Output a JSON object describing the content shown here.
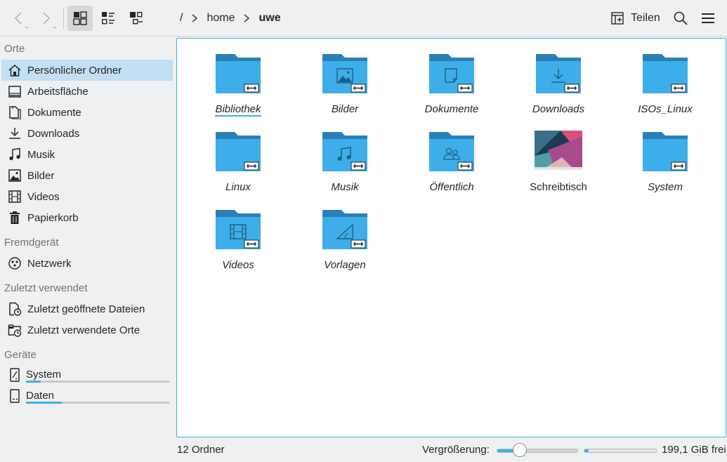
{
  "toolbar": {
    "back_icon": "go-previous-icon",
    "forward_icon": "go-next-icon",
    "view_modes": [
      "icons-view-icon",
      "details-view-icon",
      "compact-view-icon"
    ],
    "breadcrumb": [
      "/",
      "home",
      "uwe"
    ],
    "share_label": "Teilen",
    "search_icon": "search-icon",
    "menu_icon": "hamburger-menu-icon"
  },
  "sidebar": {
    "sections": {
      "places": "Orte",
      "remote": "Fremdgerät",
      "recent": "Zuletzt verwendet",
      "devices": "Geräte"
    },
    "places": [
      {
        "label": "Persönlicher Ordner",
        "icon": "home-icon",
        "selected": true
      },
      {
        "label": "Arbeitsfläche",
        "icon": "desktop-icon"
      },
      {
        "label": "Dokumente",
        "icon": "documents-icon"
      },
      {
        "label": "Downloads",
        "icon": "download-icon"
      },
      {
        "label": "Musik",
        "icon": "music-note-icon"
      },
      {
        "label": "Bilder",
        "icon": "image-icon"
      },
      {
        "label": "Videos",
        "icon": "film-icon"
      },
      {
        "label": "Papierkorb",
        "icon": "trash-icon"
      }
    ],
    "remote": [
      {
        "label": "Netzwerk",
        "icon": "network-icon"
      }
    ],
    "recent": [
      {
        "label": "Zuletzt geöffnete Dateien",
        "icon": "recent-files-icon"
      },
      {
        "label": "Zuletzt verwendete Orte",
        "icon": "recent-places-icon"
      }
    ],
    "devices": [
      {
        "label": "System",
        "icon": "drive-icon",
        "usage": 0.1
      },
      {
        "label": "Daten",
        "icon": "drive-icon",
        "usage": 0.25
      }
    ]
  },
  "content": {
    "items": [
      {
        "label": "Bibliothek",
        "icon": "folder-icon",
        "emblem": "symlink"
      },
      {
        "label": "Bilder",
        "icon": "folder-pictures-icon",
        "emblem": "symlink"
      },
      {
        "label": "Dokumente",
        "icon": "folder-documents-icon",
        "emblem": "symlink"
      },
      {
        "label": "Downloads",
        "icon": "folder-download-icon",
        "emblem": "symlink"
      },
      {
        "label": "ISOs_Linux",
        "icon": "folder-icon",
        "emblem": "symlink"
      },
      {
        "label": "Linux",
        "icon": "folder-icon",
        "emblem": "symlink"
      },
      {
        "label": "Musik",
        "icon": "folder-music-icon",
        "emblem": "symlink"
      },
      {
        "label": "Öffentlich",
        "icon": "folder-public-icon",
        "emblem": "symlink"
      },
      {
        "label": "Schreibtisch",
        "icon": "desktop-thumbnail-icon"
      },
      {
        "label": "System",
        "icon": "folder-icon",
        "emblem": "symlink"
      },
      {
        "label": "Videos",
        "icon": "folder-videos-icon",
        "emblem": "symlink"
      },
      {
        "label": "Vorlagen",
        "icon": "folder-templates-icon",
        "emblem": "symlink"
      }
    ]
  },
  "statusbar": {
    "summary": "12 Ordner",
    "zoom_label": "Vergrößerung:",
    "zoom_level": 0.25,
    "free_space_fraction": 0.06,
    "free_text": "199,1 GiB frei"
  },
  "colors": {
    "accent": "#3daee9",
    "folder_body": "#3daee9",
    "folder_tab": "#2980b9",
    "selection": "#c2dff3"
  }
}
